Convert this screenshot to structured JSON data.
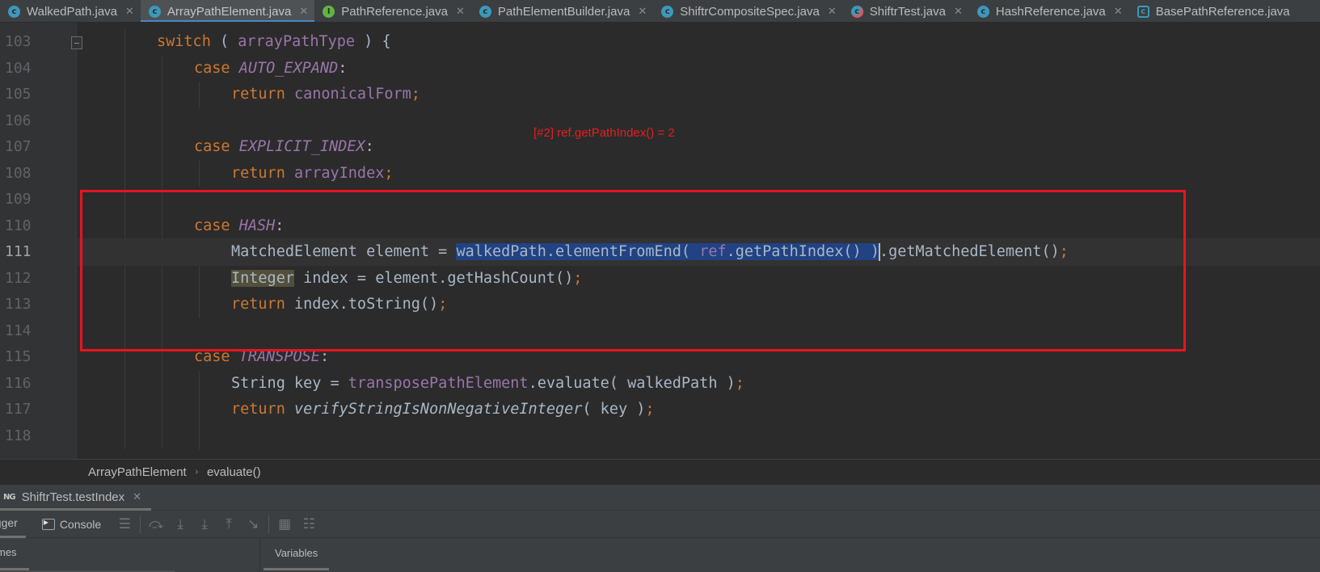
{
  "tabs": [
    {
      "label": "WalkedPath.java",
      "icon": "class-icon",
      "active": false
    },
    {
      "label": "ArrayPathElement.java",
      "icon": "class-icon",
      "active": true
    },
    {
      "label": "PathReference.java",
      "icon": "interface-icon",
      "active": false
    },
    {
      "label": "PathElementBuilder.java",
      "icon": "class-icon",
      "active": false
    },
    {
      "label": "ShiftrCompositeSpec.java",
      "icon": "class-icon",
      "active": false
    },
    {
      "label": "ShiftrTest.java",
      "icon": "test-class-icon",
      "active": false
    },
    {
      "label": "HashReference.java",
      "icon": "class-icon",
      "active": false
    },
    {
      "label": "BasePathReference.java",
      "icon": "abstract-class-icon",
      "active": false
    }
  ],
  "editor": {
    "current_line": 111,
    "inline_value": "[#2] ref.getPathIndex() = 2",
    "lines": [
      {
        "num": "103",
        "indent": 2,
        "tokens": [
          [
            "kw",
            "switch"
          ],
          [
            "id",
            " ( "
          ],
          [
            "fld",
            "arrayPathType"
          ],
          [
            "id",
            " ) {"
          ]
        ]
      },
      {
        "num": "104",
        "indent": 3,
        "tokens": [
          [
            "kw",
            "case "
          ],
          [
            "kwi",
            "AUTO_EXPAND"
          ],
          [
            "id",
            ":"
          ]
        ]
      },
      {
        "num": "105",
        "indent": 4,
        "tokens": [
          [
            "kw",
            "return "
          ],
          [
            "fld",
            "canonicalForm"
          ],
          [
            "semi",
            ";"
          ]
        ]
      },
      {
        "num": "106",
        "indent": 0,
        "tokens": []
      },
      {
        "num": "107",
        "indent": 3,
        "tokens": [
          [
            "kw",
            "case "
          ],
          [
            "kwi",
            "EXPLICIT_INDEX"
          ],
          [
            "id",
            ":"
          ]
        ]
      },
      {
        "num": "108",
        "indent": 4,
        "tokens": [
          [
            "kw",
            "return "
          ],
          [
            "fld",
            "arrayIndex"
          ],
          [
            "semi",
            ";"
          ]
        ]
      },
      {
        "num": "109",
        "indent": 0,
        "tokens": []
      },
      {
        "num": "110",
        "indent": 3,
        "tokens": [
          [
            "kw",
            "case "
          ],
          [
            "kwi",
            "HASH"
          ],
          [
            "id",
            ":"
          ]
        ]
      },
      {
        "num": "111",
        "indent": 4,
        "tokens": [
          [
            "id",
            "MatchedElement element = "
          ],
          [
            "sel",
            "walkedPath.elementFromEnd( "
          ],
          [
            "selfld",
            "ref"
          ],
          [
            "sel",
            ".getPathIndex() )"
          ],
          [
            "caret",
            ""
          ],
          [
            "id",
            ".getMatchedElement()"
          ],
          [
            "semi",
            ";"
          ]
        ]
      },
      {
        "num": "112",
        "indent": 4,
        "tokens": [
          [
            "hl",
            "Integer"
          ],
          [
            "id",
            " index = element.getHashCount()"
          ],
          [
            "semi",
            ";"
          ]
        ]
      },
      {
        "num": "113",
        "indent": 4,
        "tokens": [
          [
            "kw",
            "return "
          ],
          [
            "id",
            "index.toString()"
          ],
          [
            "semi",
            ";"
          ]
        ]
      },
      {
        "num": "114",
        "indent": 0,
        "tokens": []
      },
      {
        "num": "115",
        "indent": 3,
        "tokens": [
          [
            "kw",
            "case "
          ],
          [
            "kwi",
            "TRANSPOSE"
          ],
          [
            "id",
            ":"
          ]
        ]
      },
      {
        "num": "116",
        "indent": 4,
        "tokens": [
          [
            "id",
            "String key = "
          ],
          [
            "fld",
            "transposePathElement"
          ],
          [
            "id",
            ".evaluate( walkedPath )"
          ],
          [
            "semi",
            ";"
          ]
        ]
      },
      {
        "num": "117",
        "indent": 4,
        "tokens": [
          [
            "kw",
            "return "
          ],
          [
            "mtit",
            "verifyStringIsNonNegativeInteger"
          ],
          [
            "id",
            "( key )"
          ],
          [
            "semi",
            ";"
          ]
        ]
      },
      {
        "num": "118",
        "indent": 0,
        "tokens": []
      }
    ]
  },
  "breadcrumb": {
    "class_name": "ArrayPathElement",
    "method_name": "evaluate()"
  },
  "debug": {
    "session_tab": "ShiftrTest.testIndex",
    "session_icon_text": "NG",
    "debugger_tab": "ugger",
    "console_tab": "Console",
    "frames_label": "mes",
    "variables_label": "Variables"
  },
  "colors": {
    "keyword": "#cc7832",
    "field": "#9876aa",
    "text": "#a9b7c6",
    "selection": "#214283",
    "annotation_box": "#e8141e",
    "inline_value": "#e02020"
  }
}
